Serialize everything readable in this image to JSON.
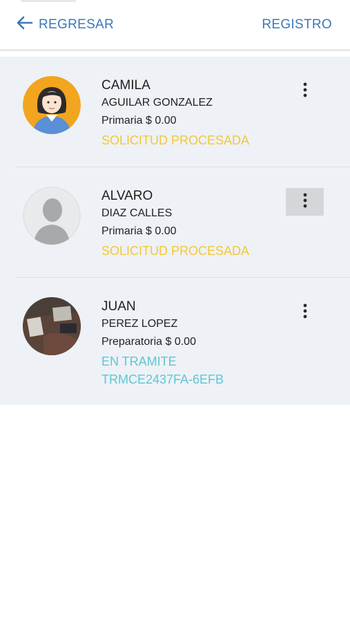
{
  "header": {
    "back_label": "REGRESAR",
    "register_label": "REGISTRO"
  },
  "students": [
    {
      "first_name": "CAMILA",
      "last_names": "AGUILAR GONZALEZ",
      "level_amount": "Primaria $ 0.00",
      "status": "SOLICITUD PROCESADA",
      "status_color": "#f3c838",
      "avatar": "girl-avatar-icon"
    },
    {
      "first_name": "ALVARO",
      "last_names": "DIAZ CALLES",
      "level_amount": "Primaria $ 0.00",
      "status": "SOLICITUD PROCESADA",
      "status_color": "#f3c838",
      "avatar": "default-user-avatar-icon"
    },
    {
      "first_name": "JUAN",
      "last_names": "PEREZ LOPEZ",
      "level_amount": "Preparatoria $ 0.00",
      "status": "EN TRAMITE",
      "status_color": "#5ec7d4",
      "code": "TRMCE2437FA-6EFB",
      "avatar": "photo-avatar"
    }
  ],
  "colors": {
    "accent": "#3a78b8",
    "list_background": "#eef1f5"
  }
}
